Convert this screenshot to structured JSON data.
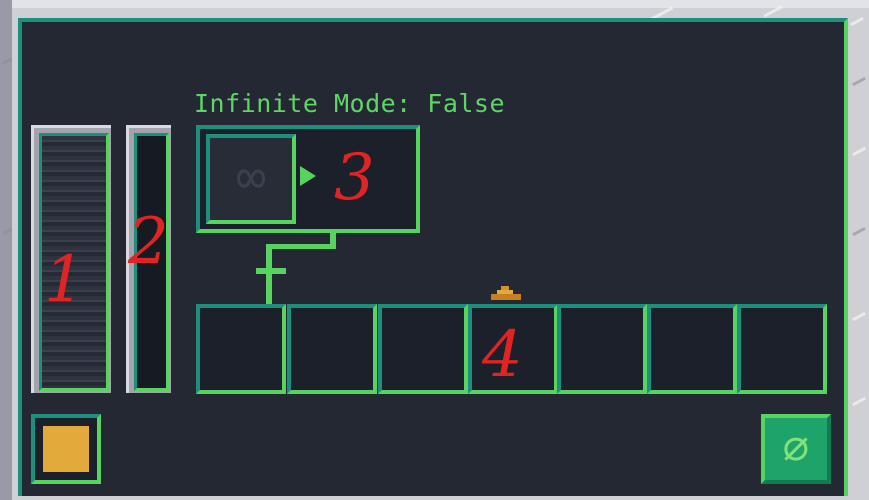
{
  "header": {
    "infinite_mode_label": "Infinite Mode: False"
  },
  "labels": {
    "one": "1",
    "two": "2",
    "three": "3",
    "four": "4"
  },
  "recipe": {
    "icon": "infinity-icon",
    "glyph": "∞"
  },
  "clear_button": {
    "icon": "clear-icon",
    "glyph": "∅"
  },
  "colors": {
    "accent_light": "#58d35f",
    "accent_dark": "#1f8f7d",
    "panel_bg": "#232833",
    "swatch": "#e2a93b",
    "annotation": "#e02424"
  },
  "output_slots": [
    {
      "name": "output-slot-1"
    },
    {
      "name": "output-slot-2"
    },
    {
      "name": "output-slot-3"
    },
    {
      "name": "output-slot-4"
    },
    {
      "name": "output-slot-5"
    },
    {
      "name": "output-slot-6"
    },
    {
      "name": "output-slot-7"
    }
  ]
}
